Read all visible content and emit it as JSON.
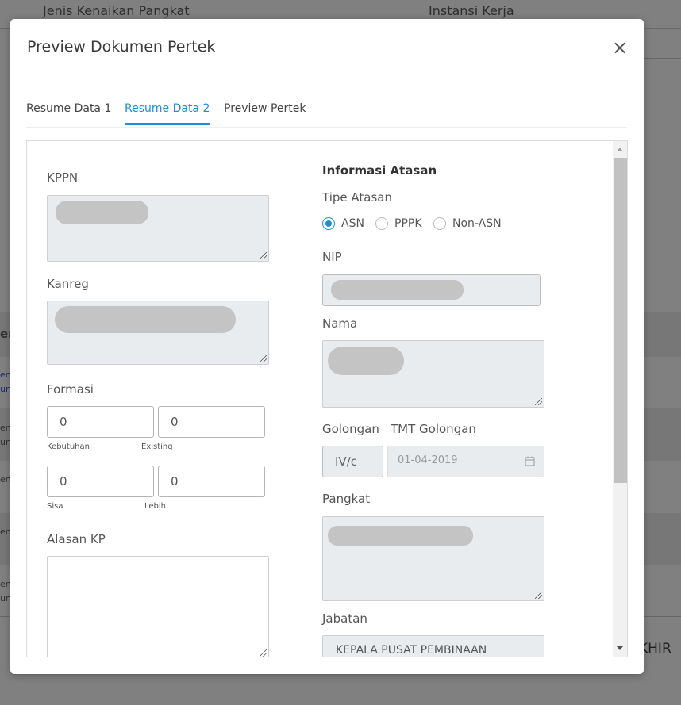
{
  "background": {
    "col_jenis": "Jenis Kenaikan Pangkat",
    "col_instansi": "Instansi Kerja",
    "akhir_fragment": "KHIR",
    "frag_en": "en",
    "frag_link1": "ene",
    "frag_link2": "ung",
    "frag_rows": [
      "ene",
      "ung",
      "ene",
      "ene",
      "ene",
      "ung"
    ]
  },
  "modal": {
    "title": "Preview Dokumen Pertek",
    "close_icon": "close-icon"
  },
  "tabs": [
    "Resume Data 1",
    "Resume Data 2",
    "Preview Pertek"
  ],
  "active_tab": 1,
  "left": {
    "kppn_label": "KPPN",
    "kanreg_label": "Kanreg",
    "formasi_label": "Formasi",
    "kebutuhan_value": "0",
    "kebutuhan_label": "Kebutuhan",
    "existing_value": "0",
    "existing_label": "Existing",
    "sisa_value": "0",
    "sisa_label": "Sisa",
    "lebih_value": "0",
    "lebih_label": "Lebih",
    "alasan_label": "Alasan KP"
  },
  "right": {
    "section_title": "Informasi Atasan",
    "tipe_label": "Tipe Atasan",
    "tipe_options": [
      "ASN",
      "PPPK",
      "Non-ASN"
    ],
    "tipe_selected": "ASN",
    "nip_label": "NIP",
    "nama_label": "Nama",
    "golongan_label": "Golongan",
    "golongan_value": "IV/c",
    "tmt_label": "TMT Golongan",
    "tmt_value": "01-04-2019",
    "pangkat_label": "Pangkat",
    "jabatan_label": "Jabatan",
    "jabatan_value": "KEPALA PUSAT PEMBINAAN"
  },
  "colors": {
    "accent": "#1b8fd4",
    "readonly_bg": "#e9ecef",
    "redacted": "#c4c4c4"
  }
}
